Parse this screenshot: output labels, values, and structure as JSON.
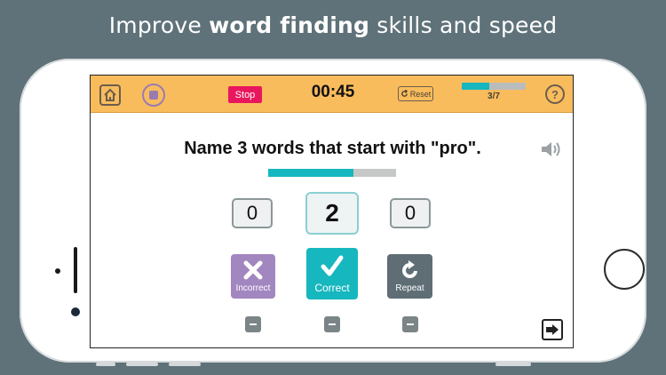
{
  "headline": {
    "pre": "Improve ",
    "bold": "word finding",
    "post": " skills and speed"
  },
  "topbar": {
    "stop_label": "Stop",
    "timer": "00:45",
    "reset_label": "Reset",
    "progress_count": "3/7",
    "progress_fraction": 0.43,
    "help_label": "?"
  },
  "prompt": "Name 3 words that start with \"pro\".",
  "task_progress_fraction": 0.67,
  "counters": {
    "incorrect": "0",
    "correct": "2",
    "repeat": "0"
  },
  "actions": {
    "incorrect": "Incorrect",
    "correct": "Correct",
    "repeat": "Repeat"
  },
  "colors": {
    "accent": "#16b7be",
    "topbar": "#f9bc5d",
    "stop": "#e8175d",
    "incorrect": "#a286c0",
    "repeat": "#5f6e75",
    "background": "#5f7279"
  },
  "icons": [
    "home-icon",
    "stop-icon",
    "reset-icon",
    "help-icon",
    "sound-icon",
    "x-icon",
    "checkmark-icon",
    "repeat-icon",
    "minus-icon",
    "arrow-right-icon"
  ]
}
